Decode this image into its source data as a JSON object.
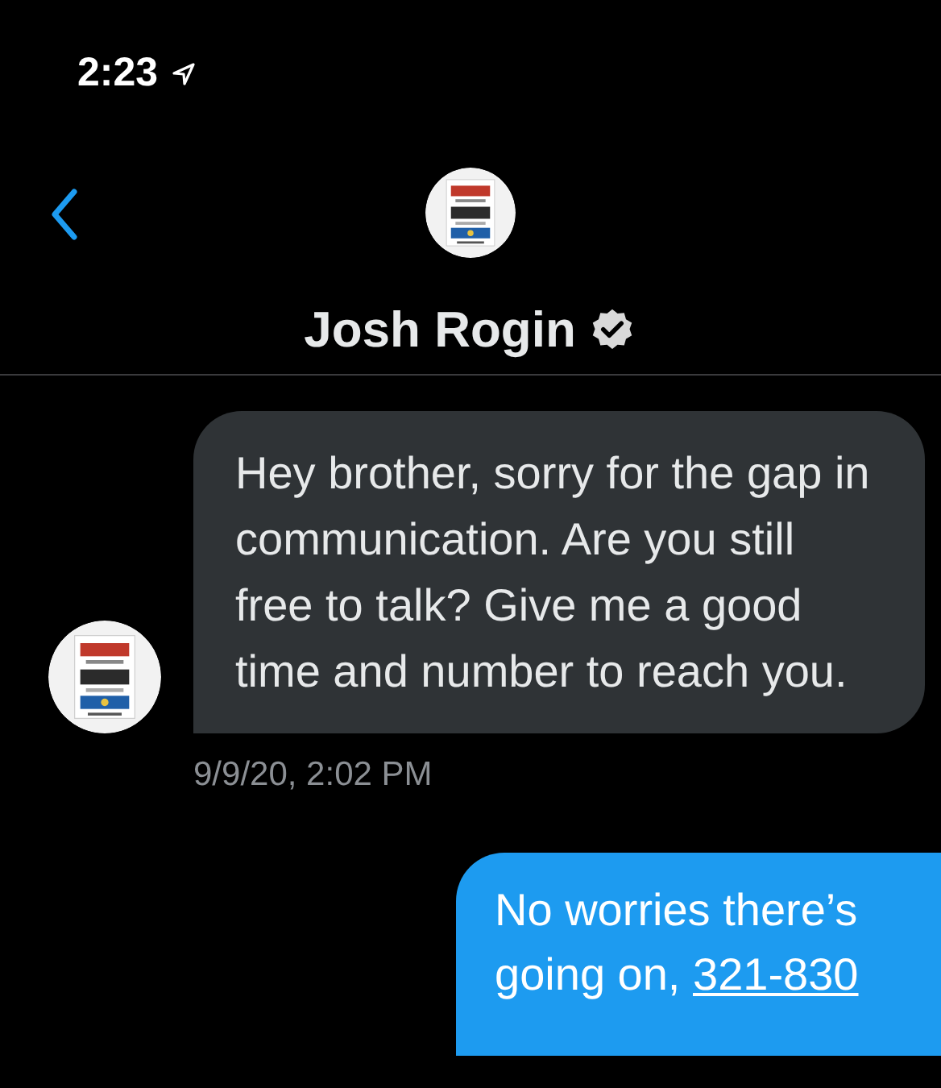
{
  "status_bar": {
    "time": "2:23"
  },
  "header": {
    "name": "Josh Rogin",
    "verified": true
  },
  "messages": [
    {
      "kind": "incoming",
      "text": "Hey brother, sorry for the gap in communication. Are you still free to talk? Give me a good time and number to reach you.",
      "timestamp": "9/9/20, 2:02 PM"
    },
    {
      "kind": "outgoing",
      "lines": [
        "No worries there’s",
        "going on, "
      ],
      "link": "321-830"
    }
  ]
}
